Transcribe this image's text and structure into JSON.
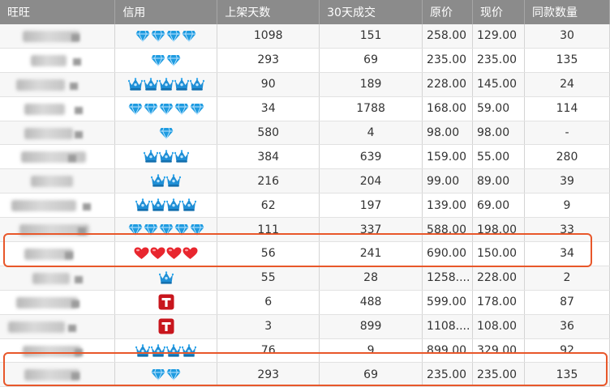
{
  "headers": [
    "旺旺",
    "信用",
    "上架天数",
    "30天成交",
    "原价",
    "现价",
    "同款数量"
  ],
  "rows": [
    {
      "credit": {
        "type": "diamond",
        "count": 4
      },
      "days": "1098",
      "sales": "151",
      "orig": "258.00",
      "now": "129.00",
      "same": "30"
    },
    {
      "credit": {
        "type": "diamond",
        "count": 2
      },
      "days": "293",
      "sales": "69",
      "orig": "235.00",
      "now": "235.00",
      "same": "135"
    },
    {
      "credit": {
        "type": "crown",
        "count": 5
      },
      "days": "90",
      "sales": "189",
      "orig": "228.00",
      "now": "145.00",
      "same": "24"
    },
    {
      "credit": {
        "type": "diamond",
        "count": 5
      },
      "days": "34",
      "sales": "1788",
      "orig": "168.00",
      "now": "59.00",
      "same": "114"
    },
    {
      "credit": {
        "type": "diamond",
        "count": 1
      },
      "days": "580",
      "sales": "4",
      "orig": "98.00",
      "now": "98.00",
      "same": "-"
    },
    {
      "credit": {
        "type": "crown",
        "count": 3
      },
      "days": "384",
      "sales": "639",
      "orig": "159.00",
      "now": "55.00",
      "same": "280"
    },
    {
      "credit": {
        "type": "crown",
        "count": 2
      },
      "days": "216",
      "sales": "204",
      "orig": "99.00",
      "now": "89.00",
      "same": "39"
    },
    {
      "credit": {
        "type": "crown",
        "count": 4
      },
      "days": "62",
      "sales": "197",
      "orig": "139.00",
      "now": "69.00",
      "same": "9"
    },
    {
      "credit": {
        "type": "diamond",
        "count": 5
      },
      "days": "111",
      "sales": "337",
      "orig": "588.00",
      "now": "198.00",
      "same": "33"
    },
    {
      "credit": {
        "type": "heart",
        "count": 4
      },
      "days": "56",
      "sales": "241",
      "orig": "690.00",
      "now": "150.00",
      "same": "34"
    },
    {
      "credit": {
        "type": "crown",
        "count": 1
      },
      "days": "55",
      "sales": "28",
      "orig": "1258....",
      "now": "228.00",
      "same": "2"
    },
    {
      "credit": {
        "type": "tmall",
        "count": 1
      },
      "days": "6",
      "sales": "488",
      "orig": "599.00",
      "now": "178.00",
      "same": "87"
    },
    {
      "credit": {
        "type": "tmall",
        "count": 1
      },
      "days": "3",
      "sales": "899",
      "orig": "1108....",
      "now": "108.00",
      "same": "36"
    },
    {
      "credit": {
        "type": "crown",
        "count": 4
      },
      "days": "76",
      "sales": "9",
      "orig": "899.00",
      "now": "329.00",
      "same": "92"
    },
    {
      "credit": {
        "type": "diamond",
        "count": 2
      },
      "days": "293",
      "sales": "69",
      "orig": "235.00",
      "now": "235.00",
      "same": "135"
    }
  ],
  "colors": {
    "header_bg": "#8b8b8b",
    "diamond": "#1e9be0",
    "crown": "#1f8fd6",
    "heart": "#e8262e",
    "tmall": "#c8161d",
    "highlight": "#e8572a"
  },
  "icons": {
    "diamond": "diamond-icon",
    "crown": "crown-icon",
    "heart": "heart-icon",
    "tmall": "tmall-badge-icon"
  }
}
